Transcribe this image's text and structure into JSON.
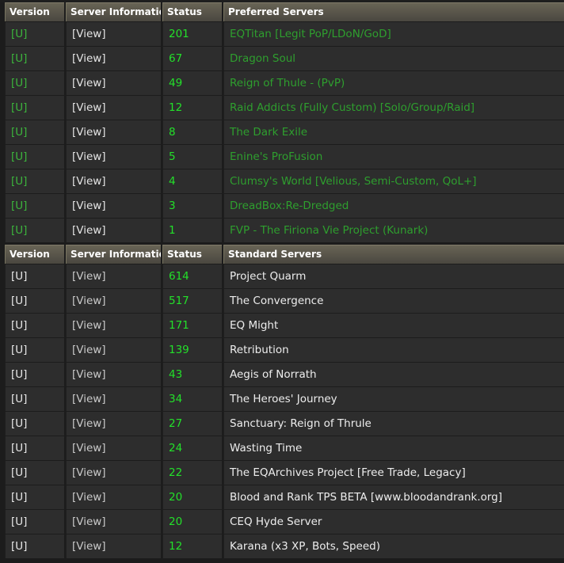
{
  "headers": {
    "version": "Version",
    "server_info": "Server Information",
    "status": "Status",
    "preferred": "Preferred Servers",
    "standard": "Standard Servers"
  },
  "preferred_servers": [
    {
      "version": "[U]",
      "info": "[View]",
      "status": "201",
      "name": "EQTitan [Legit PoP/LDoN/GoD]"
    },
    {
      "version": "[U]",
      "info": "[View]",
      "status": "67",
      "name": "Dragon Soul"
    },
    {
      "version": "[U]",
      "info": "[View]",
      "status": "49",
      "name": "Reign of Thule - (PvP)"
    },
    {
      "version": "[U]",
      "info": "[View]",
      "status": "12",
      "name": "Raid Addicts (Fully Custom) [Solo/Group/Raid]"
    },
    {
      "version": "[U]",
      "info": "[View]",
      "status": "8",
      "name": "The Dark Exile"
    },
    {
      "version": "[U]",
      "info": "[View]",
      "status": "5",
      "name": "Enine's ProFusion"
    },
    {
      "version": "[U]",
      "info": "[View]",
      "status": "4",
      "name": "Clumsy's World [Velious, Semi-Custom, QoL+]"
    },
    {
      "version": "[U]",
      "info": "[View]",
      "status": "3",
      "name": "DreadBox:Re-Dredged"
    },
    {
      "version": "[U]",
      "info": "[View]",
      "status": "1",
      "name": "FVP - The Firiona Vie Project (Kunark)"
    }
  ],
  "standard_servers": [
    {
      "version": "[U]",
      "info": "[View]",
      "status": "614",
      "name": "Project Quarm"
    },
    {
      "version": "[U]",
      "info": "[View]",
      "status": "517",
      "name": "The Convergence"
    },
    {
      "version": "[U]",
      "info": "[View]",
      "status": "171",
      "name": "EQ Might"
    },
    {
      "version": "[U]",
      "info": "[View]",
      "status": "139",
      "name": "Retribution"
    },
    {
      "version": "[U]",
      "info": "[View]",
      "status": "43",
      "name": "Aegis of Norrath"
    },
    {
      "version": "[U]",
      "info": "[View]",
      "status": "34",
      "name": "The Heroes' Journey"
    },
    {
      "version": "[U]",
      "info": "[View]",
      "status": "27",
      "name": "Sanctuary: Reign of Thrule"
    },
    {
      "version": "[U]",
      "info": "[View]",
      "status": "24",
      "name": "Wasting Time"
    },
    {
      "version": "[U]",
      "info": "[View]",
      "status": "22",
      "name": "The EQArchives Project [Free Trade, Legacy]"
    },
    {
      "version": "[U]",
      "info": "[View]",
      "status": "20",
      "name": "Blood and Rank TPS BETA [www.bloodandrank.org]"
    },
    {
      "version": "[U]",
      "info": "[View]",
      "status": "20",
      "name": "CEQ Hyde Server"
    },
    {
      "version": "[U]",
      "info": "[View]",
      "status": "12",
      "name": "Karana (x3 XP, Bots, Speed)"
    }
  ]
}
